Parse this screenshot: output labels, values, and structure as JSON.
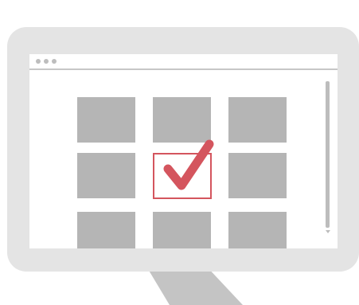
{
  "colors": {
    "monitor_frame": "#e4e4e4",
    "stand": "#c4c4c4",
    "screen": "#ffffff",
    "tile": "#b5b5b5",
    "accent": "#d4555e",
    "chrome": "#bdbdbd"
  },
  "icons": {
    "window_dots": "three-dot-icon",
    "selection_mark": "checkmark-icon"
  },
  "grid": {
    "rows": 3,
    "columns": 3,
    "selected_tile": "row 2, column 2"
  }
}
